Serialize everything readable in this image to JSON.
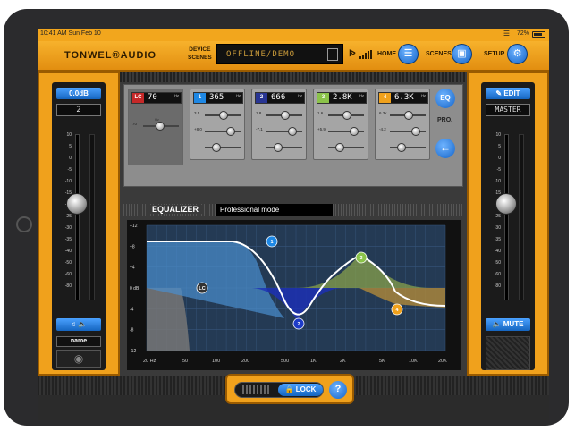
{
  "status_bar": {
    "time": "10:41 AM   Sun Feb 10",
    "battery": "72%"
  },
  "header": {
    "brand": "TONWEL®AUDIO",
    "device_label": "DEVICE",
    "scenes_label": "SCENES",
    "device_status": "OFFLINE/DEMO",
    "home_label": "HOME",
    "scenes_nav_label": "SCENES",
    "setup_label": "SETUP"
  },
  "left_channel": {
    "gain": "0.0dB",
    "channel_number": "2",
    "name": "name",
    "scale": [
      "10",
      "5",
      "0",
      "-5",
      "-10",
      "-15",
      "-20",
      "-25",
      "-30",
      "-35",
      "-40",
      "-50",
      "-60",
      "-80"
    ]
  },
  "right_channel": {
    "edit_label": "EDIT",
    "master_label": "MASTER",
    "mute_label": "MUTE"
  },
  "filters": {
    "lc": {
      "label": "LC",
      "freq": "70",
      "unit": "Hz",
      "color": "#c62828"
    },
    "bands": [
      {
        "num": "1",
        "freq": "365",
        "unit": "Hz",
        "color": "#1e88e5",
        "q": "3.5",
        "gain": "+8.0"
      },
      {
        "num": "2",
        "freq": "666",
        "unit": "Hz",
        "color": "#283593",
        "q": "1.8",
        "gain": "-7.1"
      },
      {
        "num": "3",
        "freq": "2.8K",
        "unit": "Hz",
        "color": "#8bc34a",
        "q": "1.6",
        "gain": "+5.9"
      },
      {
        "num": "4",
        "freq": "6.3K",
        "unit": "Hz",
        "color": "#f0a11c",
        "q": "6.3k",
        "gain": "-4.2"
      }
    ],
    "eq_button": "EQ",
    "pro_label": "PRO."
  },
  "equalizer": {
    "title": "EQUALIZER",
    "mode": "Professional mode",
    "y_ticks": [
      "+12",
      "+8",
      "+4",
      "0 dB",
      "-4",
      "-8",
      "-12"
    ],
    "x_ticks": [
      "20 Hz",
      "50",
      "100",
      "200",
      "500",
      "1K",
      "2K",
      "5K",
      "10K",
      "20K"
    ],
    "markers": [
      "LC",
      "1",
      "2",
      "3",
      "4"
    ]
  },
  "bottom": {
    "lock_label": "LOCK",
    "help_label": "?"
  }
}
